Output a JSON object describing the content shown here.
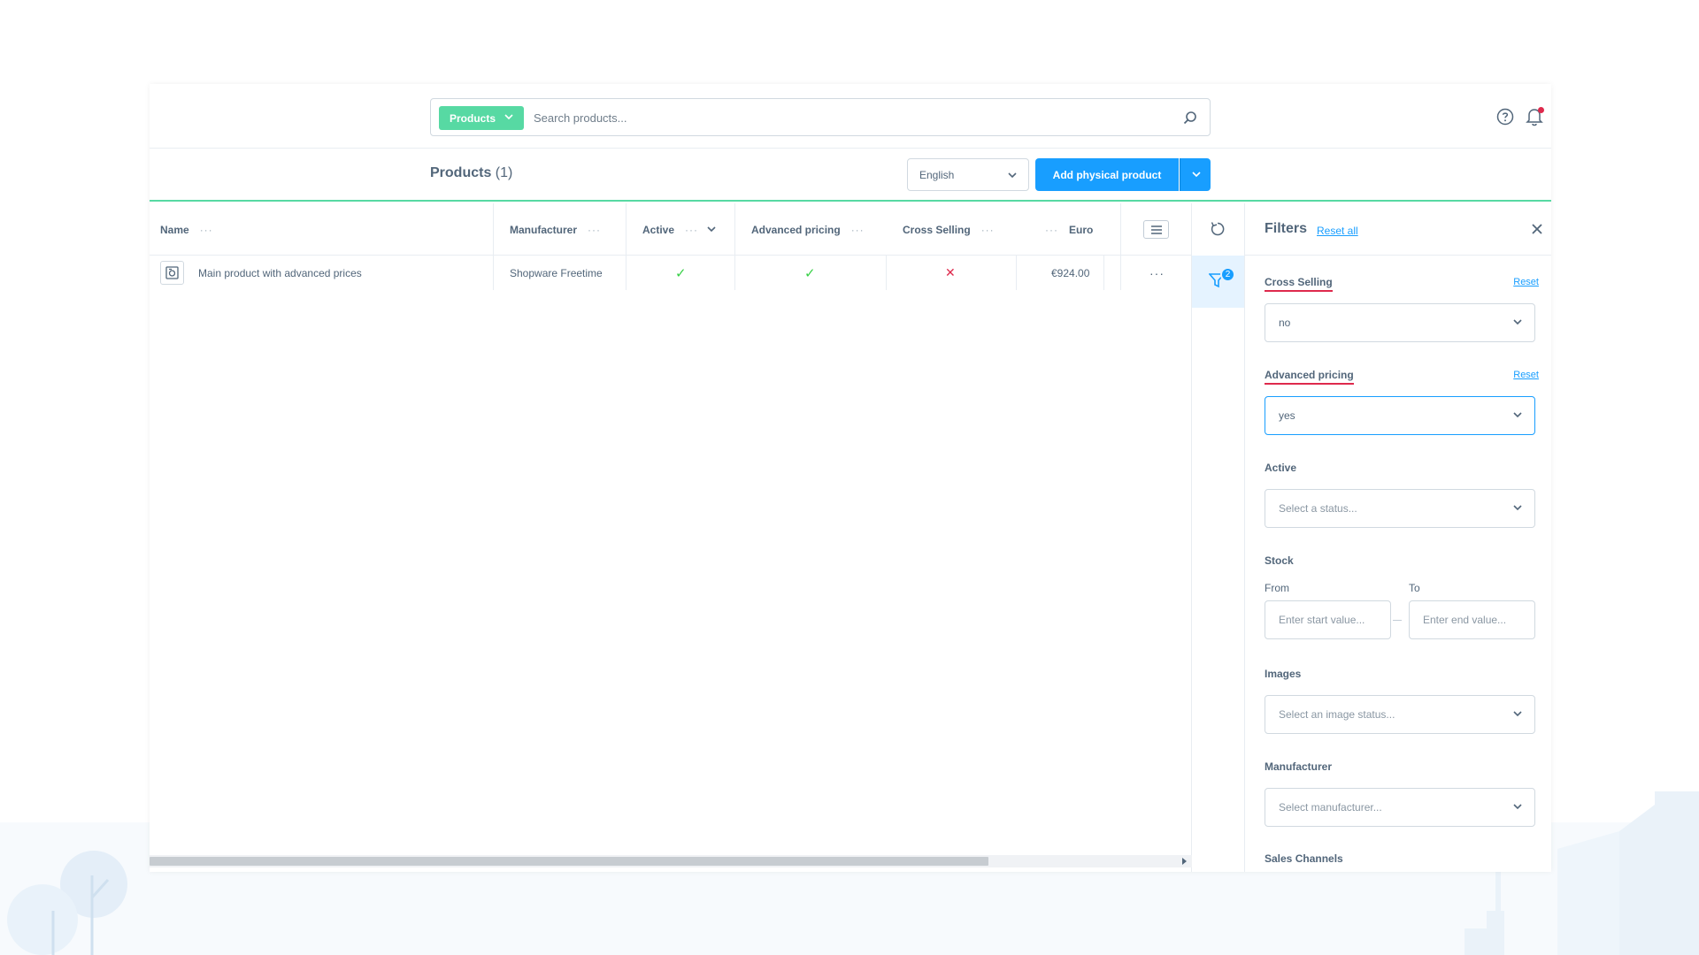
{
  "header": {
    "search_type_label": "Products",
    "search_placeholder": "Search products..."
  },
  "smartbar": {
    "title": "Products",
    "count": "(1)",
    "language": "English",
    "add_button_label": "Add physical product"
  },
  "grid": {
    "columns": [
      {
        "label": "Name"
      },
      {
        "label": "Manufacturer"
      },
      {
        "label": "Active"
      },
      {
        "label": "Advanced pricing"
      },
      {
        "label": "Cross Selling"
      },
      {
        "label": "Euro"
      }
    ],
    "rows": [
      {
        "name": "Main product with advanced prices",
        "manufacturer": "Shopware Freetime",
        "active": "✓",
        "advanced_pricing": "✓",
        "cross_selling": "✕",
        "price": "€924.00"
      }
    ],
    "row_menu": "···",
    "column_menu": "···"
  },
  "sidebar": {
    "filter_badge": "2"
  },
  "filters": {
    "title": "Filters",
    "reset_all": "Reset all",
    "reset": "Reset",
    "cross_selling": {
      "label": "Cross Selling",
      "value": "no"
    },
    "advanced_pricing": {
      "label": "Advanced pricing",
      "value": "yes"
    },
    "active": {
      "label": "Active",
      "placeholder": "Select a status..."
    },
    "stock": {
      "label": "Stock",
      "from_label": "From",
      "to_label": "To",
      "from_placeholder": "Enter start value...",
      "to_placeholder": "Enter end value..."
    },
    "images": {
      "label": "Images",
      "placeholder": "Select an image status..."
    },
    "manufacturer": {
      "label": "Manufacturer",
      "placeholder": "Select manufacturer..."
    },
    "sales_channels": {
      "label": "Sales Channels"
    }
  },
  "colors": {
    "accent_green": "#57d9a3",
    "primary_blue": "#189eff",
    "error_red": "#de294c",
    "text": "#52667a"
  }
}
